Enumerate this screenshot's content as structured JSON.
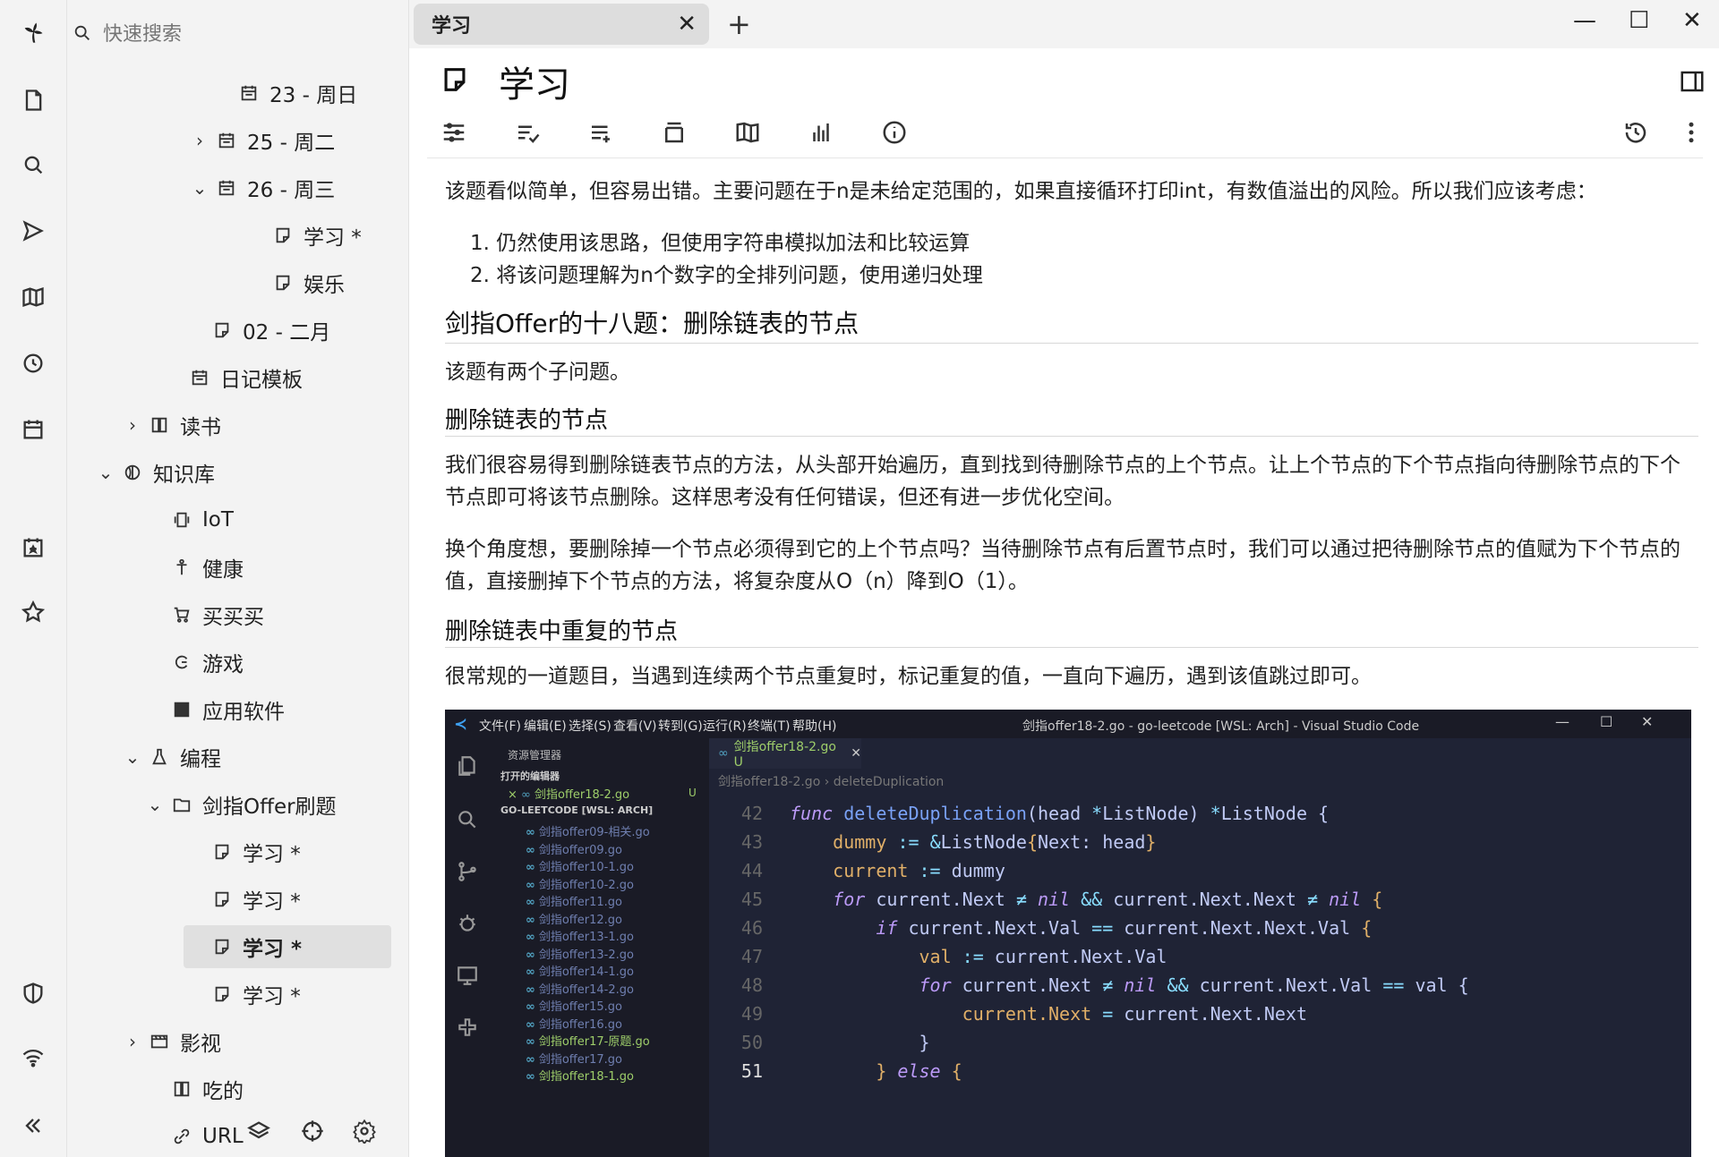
{
  "search": {
    "placeholder": "快速搜索"
  },
  "tree": [
    {
      "label": "23 - 周日",
      "icon": "calendar-icon",
      "chev": ""
    },
    {
      "label": "25 - 周二",
      "icon": "calendar-icon",
      "chev": "›"
    },
    {
      "label": "26 - 周三",
      "icon": "calendar-icon",
      "chev": "⌄"
    },
    {
      "label": "学习 *",
      "icon": "note-icon",
      "chev": ""
    },
    {
      "label": "娱乐",
      "icon": "note-icon",
      "chev": ""
    },
    {
      "label": "02 - 二月",
      "icon": "note-icon",
      "chev": ""
    },
    {
      "label": "日记模板",
      "icon": "calendar-icon",
      "chev": ""
    },
    {
      "label": "读书",
      "icon": "book-icon",
      "chev": "›"
    },
    {
      "label": "知识库",
      "icon": "globe-icon",
      "chev": "⌄"
    },
    {
      "label": "IoT",
      "icon": "device-icon",
      "chev": ""
    },
    {
      "label": "健康",
      "icon": "person-icon",
      "chev": ""
    },
    {
      "label": "买买买",
      "icon": "cart-icon",
      "chev": ""
    },
    {
      "label": "游戏",
      "icon": "game-icon",
      "chev": ""
    },
    {
      "label": "应用软件",
      "icon": "grid-icon",
      "chev": ""
    },
    {
      "label": "编程",
      "icon": "flask-icon",
      "chev": "⌄"
    },
    {
      "label": "剑指Offer刷题",
      "icon": "folder-icon",
      "chev": "⌄"
    },
    {
      "label": "学习 *",
      "icon": "note-icon",
      "chev": ""
    },
    {
      "label": "学习 *",
      "icon": "note-icon",
      "chev": ""
    },
    {
      "label": "学习 *",
      "icon": "note-icon",
      "chev": ""
    },
    {
      "label": "学习 *",
      "icon": "note-icon",
      "chev": ""
    },
    {
      "label": "影视",
      "icon": "film-icon",
      "chev": "›"
    },
    {
      "label": "吃的",
      "icon": "book-icon",
      "chev": ""
    },
    {
      "label": "URL",
      "icon": "link-icon",
      "chev": ""
    }
  ],
  "tab": {
    "title": "学习",
    "close": "✕",
    "new": "+"
  },
  "window": {
    "minimize": "—",
    "maximize": "☐",
    "close": "✕"
  },
  "note": {
    "title": "学习"
  },
  "content": {
    "p1": "该题看似简单，但容易出错。主要问题在于n是未给定范围的，如果直接循环打印int，有数值溢出的风险。所以我们应该考虑：",
    "li1": "1. 仍然使用该思路，但使用字符串模拟加法和比较运算",
    "li2": "2. 将该问题理解为n个数字的全排列问题，使用递归处理",
    "h1": "剑指Offer的十八题：删除链表的节点",
    "p2": "该题有两个子问题。",
    "h2": "删除链表的节点",
    "p3": "我们很容易得到删除链表节点的方法，从头部开始遍历，直到找到待删除节点的上个节点。让上个节点的下个节点指向待删除节点的下个节点即可将该节点删除。这样思考没有任何错误，但还有进一步优化空间。",
    "p4": "换个角度想，要删除掉一个节点必须得到它的上个节点吗？当待删除节点有后置节点时，我们可以通过把待删除节点的值赋为下个节点的值，直接删掉下个节点的方法，将复杂度从O（n）降到O（1）。",
    "h3": "删除链表中重复的节点",
    "p5": "很常规的一道题目，当遇到连续两个节点重复时，标记重复的值，一直向下遍历，遇到该值跳过即可。"
  },
  "vscode": {
    "menus": [
      "文件(F)",
      "编辑(E)",
      "选择(S)",
      "查看(V)",
      "转到(G)",
      "运行(R)",
      "终端(T)",
      "帮助(H)"
    ],
    "title": "剑指offer18-2.go - go-leetcode [WSL: Arch] - Visual Studio Code",
    "explorer_title": "资源管理器",
    "open_editors": "打开的编辑器",
    "open_file": "剑指offer18-2.go",
    "open_file_status": "U",
    "workspace": "GO-LEETCODE [WSL: ARCH]",
    "files": [
      "剑指offer09-相关.go",
      "剑指offer09.go",
      "剑指offer10-1.go",
      "剑指offer10-2.go",
      "剑指offer11.go",
      "剑指offer12.go",
      "剑指offer13-1.go",
      "剑指offer13-2.go",
      "剑指offer14-1.go",
      "剑指offer14-2.go",
      "剑指offer15.go",
      "剑指offer16.go",
      "剑指offer17-原题.go",
      "剑指offer17.go",
      "剑指offer18-1.go"
    ],
    "tab_label": "剑指offer18-2.go U",
    "crumb": "剑指offer18-2.go › deleteDuplication",
    "line_numbers": [
      "42",
      "43",
      "44",
      "45",
      "46",
      "47",
      "48",
      "49",
      "50",
      "51"
    ]
  }
}
